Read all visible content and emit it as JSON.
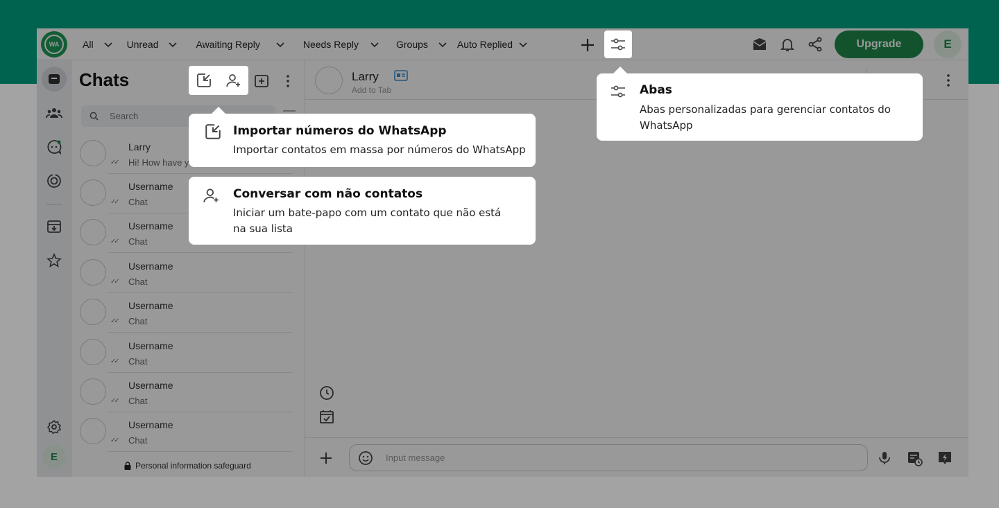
{
  "app": {
    "logo_text": "WA",
    "tabs": [
      {
        "label": "All"
      },
      {
        "label": "Unread"
      },
      {
        "label": "Awaiting Reply"
      },
      {
        "label": "Needs Reply"
      },
      {
        "label": "Groups"
      },
      {
        "label": "Auto Replied"
      }
    ],
    "upgrade_label": "Upgrade",
    "user_initial": "E"
  },
  "chat_list": {
    "title": "Chats",
    "search_placeholder": "Search",
    "items": [
      {
        "name": "Larry",
        "preview": "Hi! How have yo"
      },
      {
        "name": "Username",
        "preview": "Chat"
      },
      {
        "name": "Username",
        "preview": "Chat"
      },
      {
        "name": "Username",
        "preview": "Chat"
      },
      {
        "name": "Username",
        "preview": "Chat"
      },
      {
        "name": "Username",
        "preview": "Chat"
      },
      {
        "name": "Username",
        "preview": "Chat"
      },
      {
        "name": "Username",
        "preview": "Chat"
      }
    ],
    "safeguard": "Personal information safeguard"
  },
  "conversation": {
    "contact_name": "Larry",
    "subtitle": "Add to Tab",
    "input_placeholder": "Input message"
  },
  "tooltips": {
    "tabs": {
      "title": "Abas",
      "desc": "Abas personalizadas para gerenciar contatos do WhatsApp"
    },
    "import": {
      "title": "Importar números do WhatsApp",
      "desc": "Importar contatos em massa por números do WhatsApp"
    },
    "noncontact": {
      "title": "Conversar com não contatos",
      "desc": "Iniciar um bate-papo com um contato que não está na sua lista"
    }
  },
  "colors": {
    "brand_dark": "#006350",
    "accent_green": "#1e8b4c",
    "overlay": "rgba(0,0,0,0.40)"
  }
}
